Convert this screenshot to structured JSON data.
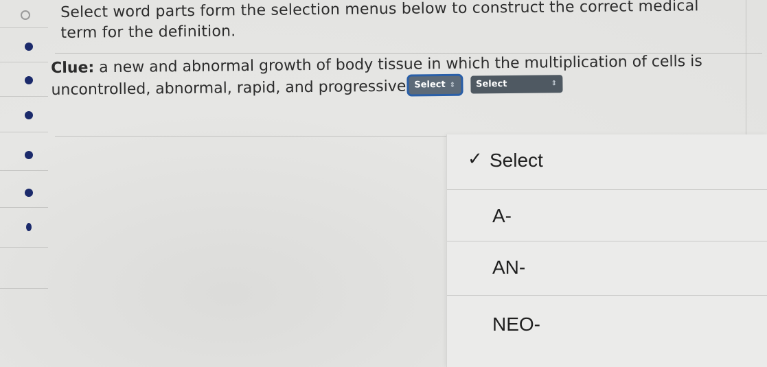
{
  "question": {
    "instruction": "Select word parts form the selection menus below to construct the correct medical term for the definition.",
    "clue_label": "Clue:",
    "clue_text": " a new and abnormal growth of body tissue in which the multiplication of cells is uncontrolled, abnormal, rapid, and progressive",
    "select_1": "Select",
    "select_2": "Select"
  },
  "dropdown": {
    "options": [
      {
        "label": "Select",
        "checked": true
      },
      {
        "label": "A-"
      },
      {
        "label": "AN-"
      },
      {
        "label": "NEO-"
      }
    ],
    "check_glyph": "✓"
  },
  "colors": {
    "bullet": "#1b2a6b",
    "select_bg": "#5d6a78",
    "select_focus": "#2a5fa8"
  }
}
